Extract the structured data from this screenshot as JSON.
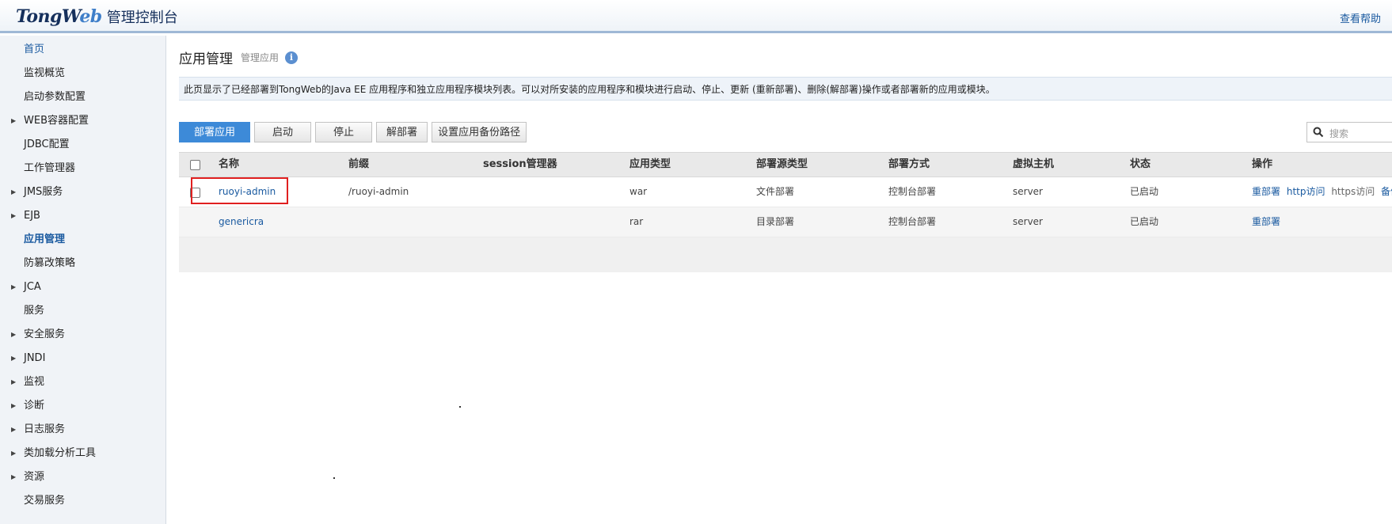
{
  "header": {
    "logo_brand_a": "TongW",
    "logo_brand_b": "eb",
    "logo_sub": "管理控制台",
    "help": "查看帮助"
  },
  "sidebar": {
    "items": [
      {
        "label": "首页",
        "expandable": false,
        "state": "link"
      },
      {
        "label": "监视概览",
        "expandable": false
      },
      {
        "label": "启动参数配置",
        "expandable": false
      },
      {
        "label": "WEB容器配置",
        "expandable": true
      },
      {
        "label": "JDBC配置",
        "expandable": false
      },
      {
        "label": "工作管理器",
        "expandable": false
      },
      {
        "label": "JMS服务",
        "expandable": true
      },
      {
        "label": "EJB",
        "expandable": true
      },
      {
        "label": "应用管理",
        "expandable": false,
        "state": "active"
      },
      {
        "label": "防篡改策略",
        "expandable": false
      },
      {
        "label": "JCA",
        "expandable": true
      },
      {
        "label": "服务",
        "expandable": false
      },
      {
        "label": "安全服务",
        "expandable": true
      },
      {
        "label": "JNDI",
        "expandable": true
      },
      {
        "label": "监视",
        "expandable": true
      },
      {
        "label": "诊断",
        "expandable": true
      },
      {
        "label": "日志服务",
        "expandable": true
      },
      {
        "label": "类加载分析工具",
        "expandable": true
      },
      {
        "label": "资源",
        "expandable": true
      },
      {
        "label": "交易服务",
        "expandable": false
      }
    ]
  },
  "main": {
    "title": "应用管理",
    "subtitle": "管理应用",
    "info_icon": "i",
    "description": "此页显示了已经部署到TongWeb的Java EE 应用程序和独立应用程序模块列表。可以对所安装的应用程序和模块进行启动、停止、更新 (重新部署)、删除(解部署)操作或者部署新的应用或模块。",
    "toolbar": {
      "deploy": "部署应用",
      "start": "启动",
      "stop": "停止",
      "undeploy": "解部署",
      "backup_path": "设置应用备份路径"
    },
    "search_placeholder": "搜索",
    "table": {
      "headers": {
        "name": "名称",
        "prefix": "前缀",
        "session": "session管理器",
        "type": "应用类型",
        "source_type": "部署源类型",
        "method": "部署方式",
        "vhost": "虚拟主机",
        "status": "状态",
        "ops": "操作"
      },
      "rows": [
        {
          "name": "ruoyi-admin",
          "prefix": "/ruoyi-admin",
          "session": "",
          "type": "war",
          "source_type": "文件部署",
          "method": "控制台部署",
          "vhost": "server",
          "status": "已启动",
          "op_redeploy": "重部署",
          "op_http": "http访问",
          "op_https": "https访问",
          "op_backup": "备份",
          "has_checkbox": true
        },
        {
          "name": "genericra",
          "prefix": "",
          "session": "",
          "type": "rar",
          "source_type": "目录部署",
          "method": "控制台部署",
          "vhost": "server",
          "status": "已启动",
          "op_redeploy": "重部署",
          "has_checkbox": false
        }
      ]
    }
  },
  "colors": {
    "accent": "#3d8ad8",
    "link": "#1a5aa0",
    "highlight_box": "#e02020"
  }
}
